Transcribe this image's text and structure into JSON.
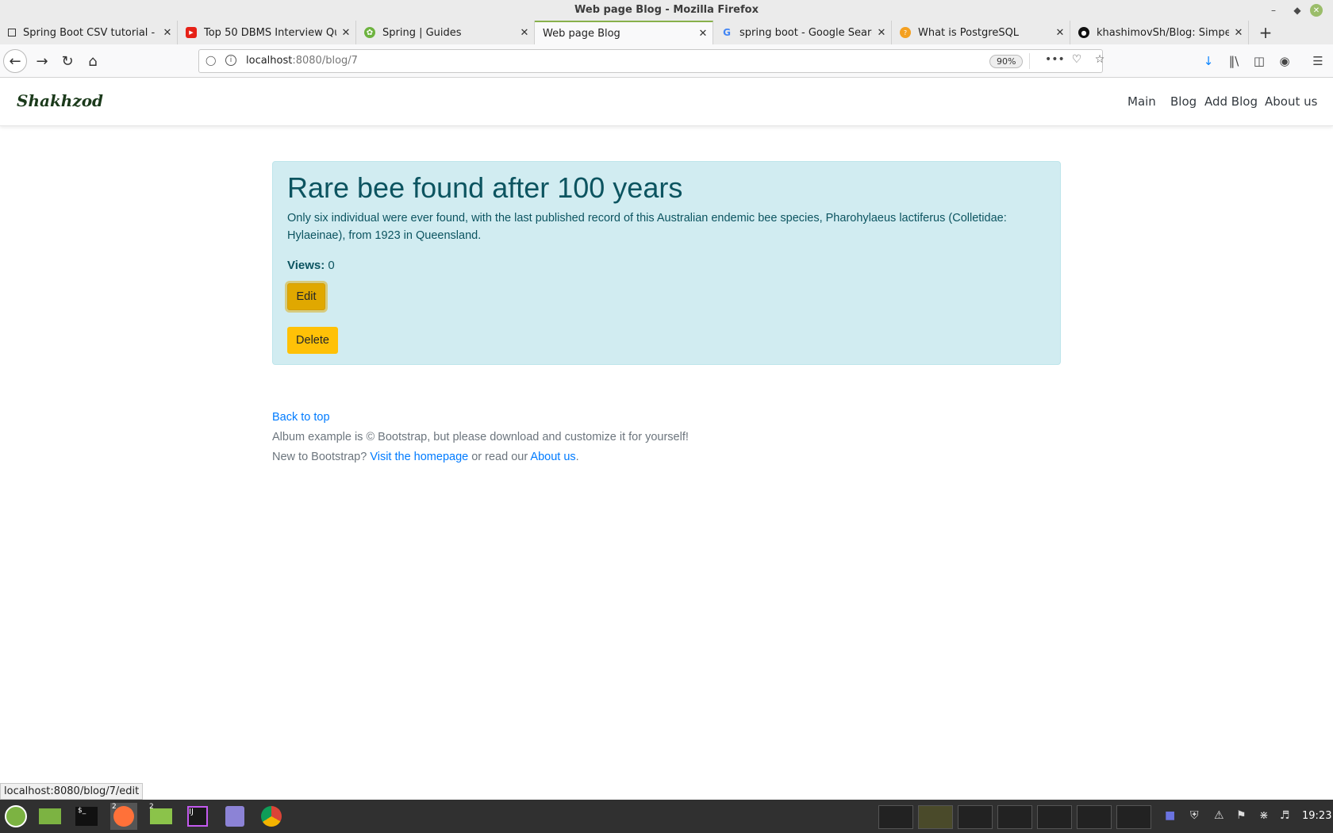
{
  "window": {
    "title": "Web page Blog - Mozilla Firefox"
  },
  "tabs": [
    {
      "label": "Spring Boot CSV tutorial - s",
      "icon": "page-icon"
    },
    {
      "label": "Top 50 DBMS Interview Qu",
      "icon": "youtube-icon"
    },
    {
      "label": "Spring | Guides",
      "icon": "spring-icon"
    },
    {
      "label": "Web page Blog",
      "icon": "none"
    },
    {
      "label": "spring boot - Google Searc",
      "icon": "google-icon"
    },
    {
      "label": "What is PostgreSQL",
      "icon": "postgres-icon"
    },
    {
      "label": "khashimovSh/Blog: Simpe",
      "icon": "github-icon"
    }
  ],
  "urlbar": {
    "host": "localhost",
    "path": ":8080/blog/7",
    "zoom": "90%"
  },
  "site": {
    "brand": "Shakhzod",
    "nav": [
      "Main",
      "Blog",
      "Add Blog",
      "About us"
    ]
  },
  "post": {
    "title": "Rare bee found after 100 years",
    "body": "Only six individual were ever found, with the last published record of this Australian endemic bee species, Pharohylaeus lactiferus (Colletidae: Hylaeinae), from 1923 in Queensland.",
    "views_label": "Views:",
    "views_value": "0",
    "edit_label": "Edit",
    "delete_label": "Delete"
  },
  "footer": {
    "back_to_top": "Back to top",
    "line1": "Album example is © Bootstrap, but please download and customize it for yourself!",
    "line2_prefix": "New to Bootstrap?",
    "visit_link": "Visit the homepage",
    "line2_middle": "or read our",
    "about_link": "About us",
    "line2_suffix": "."
  },
  "status_url": "localhost:8080/blog/7/edit",
  "taskbar": {
    "badges": [
      "2",
      "2"
    ],
    "clock": "19:23"
  },
  "colors": {
    "alert_bg": "#d1ecf1",
    "alert_text": "#0c5460",
    "warning": "#ffc107",
    "link": "#007bff",
    "tab_accent": "#88b04b"
  }
}
